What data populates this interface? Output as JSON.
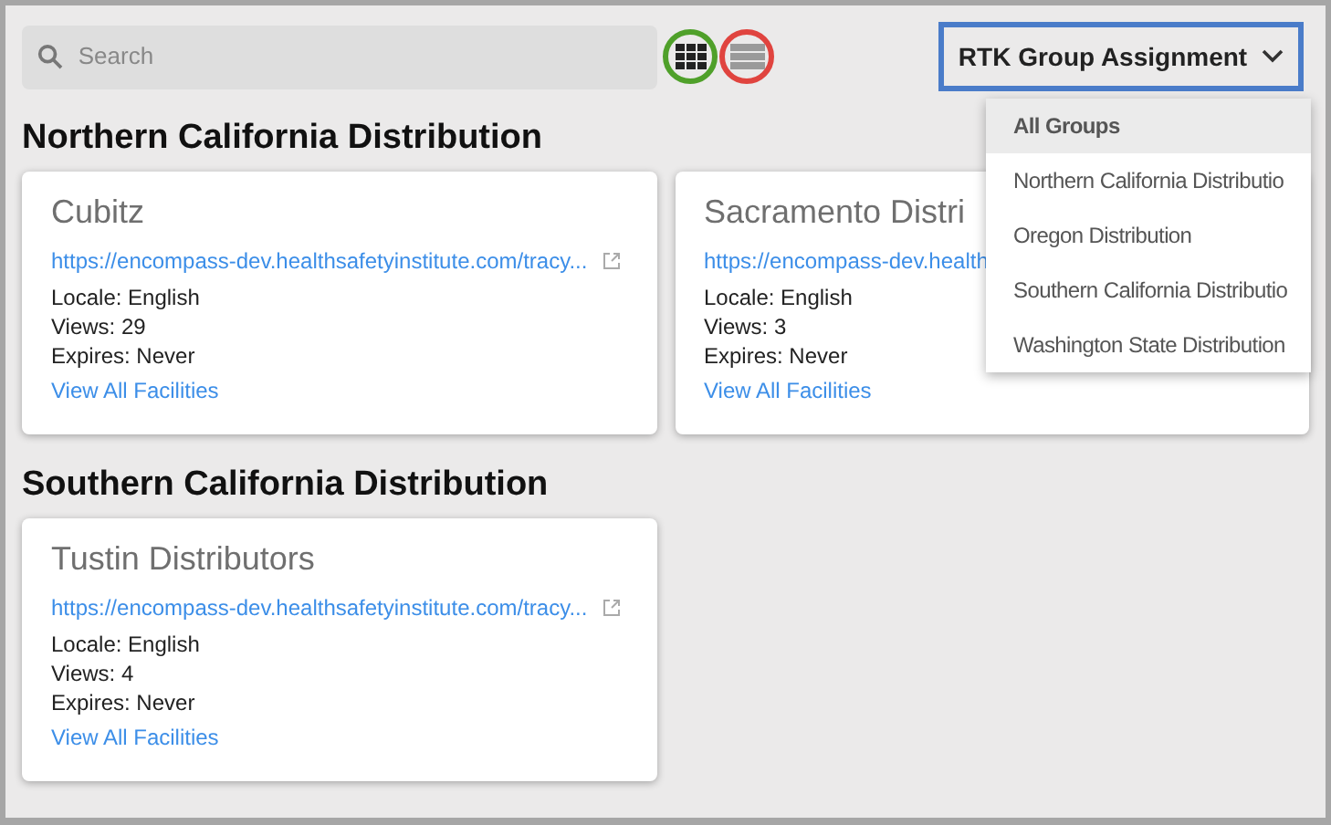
{
  "search": {
    "placeholder": "Search"
  },
  "view_toggles": [
    {
      "kind": "grid",
      "selected": true,
      "color": "#4fa02a"
    },
    {
      "kind": "list",
      "selected": false,
      "color": "#e0443f"
    }
  ],
  "group_dropdown": {
    "label": "RTK Group Assignment",
    "highlighted": true,
    "expanded": true,
    "items": [
      {
        "label": "All Groups",
        "selected": true
      },
      {
        "label": "Northern California Distributio",
        "selected": false
      },
      {
        "label": "Oregon Distribution",
        "selected": false
      },
      {
        "label": "Southern California Distributio",
        "selected": false
      },
      {
        "label": "Washington State Distribution",
        "selected": false
      }
    ]
  },
  "groups": [
    {
      "title": "Northern California Distribution",
      "cards": [
        {
          "name": "Cubitz",
          "url": "https://encompass-dev.healthsafetyinstitute.com/tracy...",
          "external_icon": true,
          "locale": "Locale: English",
          "views": "Views: 29",
          "expires": "Expires: Never",
          "link": "View All Facilities"
        },
        {
          "name": "Sacramento Distri",
          "url": "https://encompass-dev.health",
          "external_icon": false,
          "locale": "Locale: English",
          "views": "Views: 3",
          "expires": "Expires: Never",
          "link": "View All Facilities"
        }
      ]
    },
    {
      "title": "Southern California Distribution",
      "cards": [
        {
          "name": "Tustin Distributors",
          "url": "https://encompass-dev.healthsafetyinstitute.com/tracy...",
          "external_icon": true,
          "locale": "Locale: English",
          "views": "Views: 4",
          "expires": "Expires: Never",
          "link": "View All Facilities"
        }
      ]
    }
  ]
}
